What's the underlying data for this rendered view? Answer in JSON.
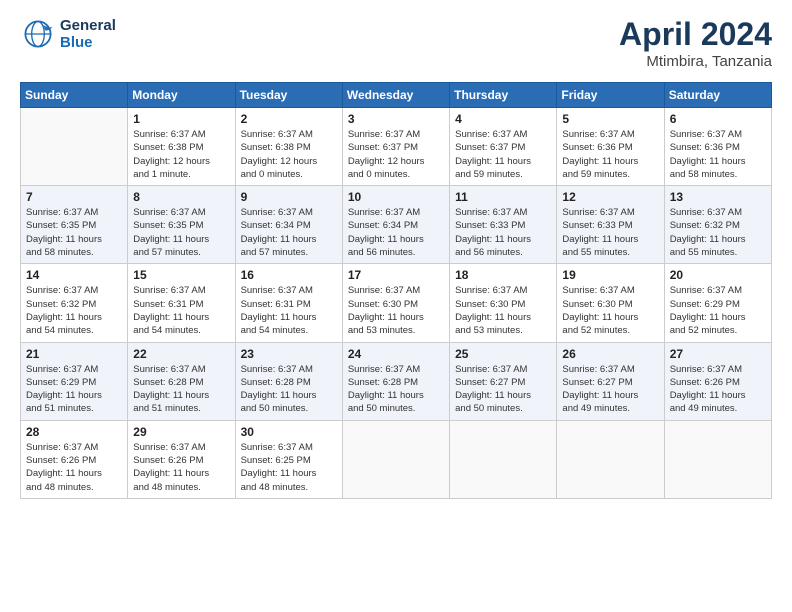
{
  "logo": {
    "line1": "General",
    "line2": "Blue"
  },
  "header": {
    "month": "April 2024",
    "location": "Mtimbira, Tanzania"
  },
  "weekdays": [
    "Sunday",
    "Monday",
    "Tuesday",
    "Wednesday",
    "Thursday",
    "Friday",
    "Saturday"
  ],
  "weeks": [
    [
      {
        "day": "",
        "info": ""
      },
      {
        "day": "1",
        "info": "Sunrise: 6:37 AM\nSunset: 6:38 PM\nDaylight: 12 hours\nand 1 minute."
      },
      {
        "day": "2",
        "info": "Sunrise: 6:37 AM\nSunset: 6:38 PM\nDaylight: 12 hours\nand 0 minutes."
      },
      {
        "day": "3",
        "info": "Sunrise: 6:37 AM\nSunset: 6:37 PM\nDaylight: 12 hours\nand 0 minutes."
      },
      {
        "day": "4",
        "info": "Sunrise: 6:37 AM\nSunset: 6:37 PM\nDaylight: 11 hours\nand 59 minutes."
      },
      {
        "day": "5",
        "info": "Sunrise: 6:37 AM\nSunset: 6:36 PM\nDaylight: 11 hours\nand 59 minutes."
      },
      {
        "day": "6",
        "info": "Sunrise: 6:37 AM\nSunset: 6:36 PM\nDaylight: 11 hours\nand 58 minutes."
      }
    ],
    [
      {
        "day": "7",
        "info": "Sunrise: 6:37 AM\nSunset: 6:35 PM\nDaylight: 11 hours\nand 58 minutes."
      },
      {
        "day": "8",
        "info": "Sunrise: 6:37 AM\nSunset: 6:35 PM\nDaylight: 11 hours\nand 57 minutes."
      },
      {
        "day": "9",
        "info": "Sunrise: 6:37 AM\nSunset: 6:34 PM\nDaylight: 11 hours\nand 57 minutes."
      },
      {
        "day": "10",
        "info": "Sunrise: 6:37 AM\nSunset: 6:34 PM\nDaylight: 11 hours\nand 56 minutes."
      },
      {
        "day": "11",
        "info": "Sunrise: 6:37 AM\nSunset: 6:33 PM\nDaylight: 11 hours\nand 56 minutes."
      },
      {
        "day": "12",
        "info": "Sunrise: 6:37 AM\nSunset: 6:33 PM\nDaylight: 11 hours\nand 55 minutes."
      },
      {
        "day": "13",
        "info": "Sunrise: 6:37 AM\nSunset: 6:32 PM\nDaylight: 11 hours\nand 55 minutes."
      }
    ],
    [
      {
        "day": "14",
        "info": "Sunrise: 6:37 AM\nSunset: 6:32 PM\nDaylight: 11 hours\nand 54 minutes."
      },
      {
        "day": "15",
        "info": "Sunrise: 6:37 AM\nSunset: 6:31 PM\nDaylight: 11 hours\nand 54 minutes."
      },
      {
        "day": "16",
        "info": "Sunrise: 6:37 AM\nSunset: 6:31 PM\nDaylight: 11 hours\nand 54 minutes."
      },
      {
        "day": "17",
        "info": "Sunrise: 6:37 AM\nSunset: 6:30 PM\nDaylight: 11 hours\nand 53 minutes."
      },
      {
        "day": "18",
        "info": "Sunrise: 6:37 AM\nSunset: 6:30 PM\nDaylight: 11 hours\nand 53 minutes."
      },
      {
        "day": "19",
        "info": "Sunrise: 6:37 AM\nSunset: 6:30 PM\nDaylight: 11 hours\nand 52 minutes."
      },
      {
        "day": "20",
        "info": "Sunrise: 6:37 AM\nSunset: 6:29 PM\nDaylight: 11 hours\nand 52 minutes."
      }
    ],
    [
      {
        "day": "21",
        "info": "Sunrise: 6:37 AM\nSunset: 6:29 PM\nDaylight: 11 hours\nand 51 minutes."
      },
      {
        "day": "22",
        "info": "Sunrise: 6:37 AM\nSunset: 6:28 PM\nDaylight: 11 hours\nand 51 minutes."
      },
      {
        "day": "23",
        "info": "Sunrise: 6:37 AM\nSunset: 6:28 PM\nDaylight: 11 hours\nand 50 minutes."
      },
      {
        "day": "24",
        "info": "Sunrise: 6:37 AM\nSunset: 6:28 PM\nDaylight: 11 hours\nand 50 minutes."
      },
      {
        "day": "25",
        "info": "Sunrise: 6:37 AM\nSunset: 6:27 PM\nDaylight: 11 hours\nand 50 minutes."
      },
      {
        "day": "26",
        "info": "Sunrise: 6:37 AM\nSunset: 6:27 PM\nDaylight: 11 hours\nand 49 minutes."
      },
      {
        "day": "27",
        "info": "Sunrise: 6:37 AM\nSunset: 6:26 PM\nDaylight: 11 hours\nand 49 minutes."
      }
    ],
    [
      {
        "day": "28",
        "info": "Sunrise: 6:37 AM\nSunset: 6:26 PM\nDaylight: 11 hours\nand 48 minutes."
      },
      {
        "day": "29",
        "info": "Sunrise: 6:37 AM\nSunset: 6:26 PM\nDaylight: 11 hours\nand 48 minutes."
      },
      {
        "day": "30",
        "info": "Sunrise: 6:37 AM\nSunset: 6:25 PM\nDaylight: 11 hours\nand 48 minutes."
      },
      {
        "day": "",
        "info": ""
      },
      {
        "day": "",
        "info": ""
      },
      {
        "day": "",
        "info": ""
      },
      {
        "day": "",
        "info": ""
      }
    ]
  ]
}
